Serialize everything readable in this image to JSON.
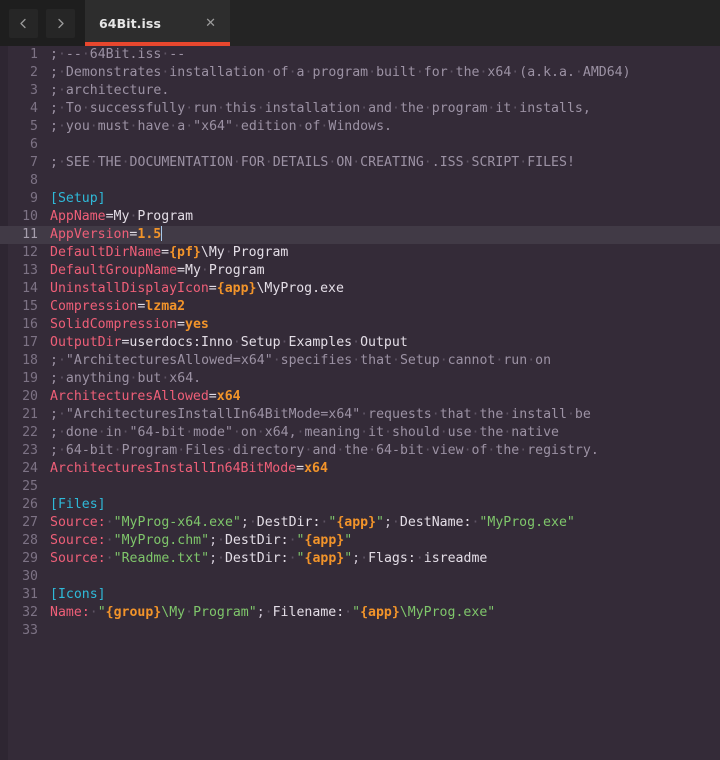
{
  "window": {
    "background": "#342b38",
    "tabbar_background": "#1e1e1e",
    "accent": "#e8472e"
  },
  "toolbar": {
    "back_label": "‹",
    "forward_label": "›",
    "back_icon": "chevron-left-icon",
    "forward_icon": "chevron-right-icon"
  },
  "tab": {
    "title": "64Bit.iss",
    "close_label": "✕",
    "active": true
  },
  "editor": {
    "language": "inno-setup-script",
    "active_line": 11,
    "cursor_after": "1.5",
    "total_lines": 33,
    "whitespace_dot": "·",
    "lines": [
      {
        "n": 1,
        "text": "; -- 64Bit.iss --"
      },
      {
        "n": 2,
        "text": "; Demonstrates installation of a program built for the x64 (a.k.a. AMD64)"
      },
      {
        "n": 3,
        "text": "; architecture."
      },
      {
        "n": 4,
        "text": "; To successfully run this installation and the program it installs,"
      },
      {
        "n": 5,
        "text": "; you must have a \"x64\" edition of Windows."
      },
      {
        "n": 6,
        "text": ""
      },
      {
        "n": 7,
        "text": "; SEE THE DOCUMENTATION FOR DETAILS ON CREATING .ISS SCRIPT FILES!"
      },
      {
        "n": 8,
        "text": ""
      },
      {
        "n": 9,
        "text": "[Setup]"
      },
      {
        "n": 10,
        "text": "AppName=My Program"
      },
      {
        "n": 11,
        "text": "AppVersion=1.5"
      },
      {
        "n": 12,
        "text": "DefaultDirName={pf}\\My Program"
      },
      {
        "n": 13,
        "text": "DefaultGroupName=My Program"
      },
      {
        "n": 14,
        "text": "UninstallDisplayIcon={app}\\MyProg.exe"
      },
      {
        "n": 15,
        "text": "Compression=lzma2"
      },
      {
        "n": 16,
        "text": "SolidCompression=yes"
      },
      {
        "n": 17,
        "text": "OutputDir=userdocs:Inno Setup Examples Output"
      },
      {
        "n": 18,
        "text": "; \"ArchitecturesAllowed=x64\" specifies that Setup cannot run on"
      },
      {
        "n": 19,
        "text": "; anything but x64."
      },
      {
        "n": 20,
        "text": "ArchitecturesAllowed=x64"
      },
      {
        "n": 21,
        "text": "; \"ArchitecturesInstallIn64BitMode=x64\" requests that the install be"
      },
      {
        "n": 22,
        "text": "; done in \"64-bit mode\" on x64, meaning it should use the native"
      },
      {
        "n": 23,
        "text": "; 64-bit Program Files directory and the 64-bit view of the registry."
      },
      {
        "n": 24,
        "text": "ArchitecturesInstallIn64BitMode=x64"
      },
      {
        "n": 25,
        "text": ""
      },
      {
        "n": 26,
        "text": "[Files]"
      },
      {
        "n": 27,
        "text": "Source: \"MyProg-x64.exe\"; DestDir: \"{app}\"; DestName: \"MyProg.exe\""
      },
      {
        "n": 28,
        "text": "Source: \"MyProg.chm\"; DestDir: \"{app}\""
      },
      {
        "n": 29,
        "text": "Source: \"Readme.txt\"; DestDir: \"{app}\"; Flags: isreadme"
      },
      {
        "n": 30,
        "text": ""
      },
      {
        "n": 31,
        "text": "[Icons]"
      },
      {
        "n": 32,
        "text": "Name: \"{group}\\My Program\"; Filename: \"{app}\\MyProg.exe\""
      },
      {
        "n": 33,
        "text": ""
      }
    ]
  },
  "colors": {
    "comment": "#9c92a4",
    "section": "#2fb9d8",
    "key": "#ef5f78",
    "string": "#7fc66b",
    "constant": "#f2942a",
    "value": "#f2942a",
    "plain": "#e3dde6",
    "linenumber": "#7d7385",
    "active_line_bg": "#413a46"
  }
}
